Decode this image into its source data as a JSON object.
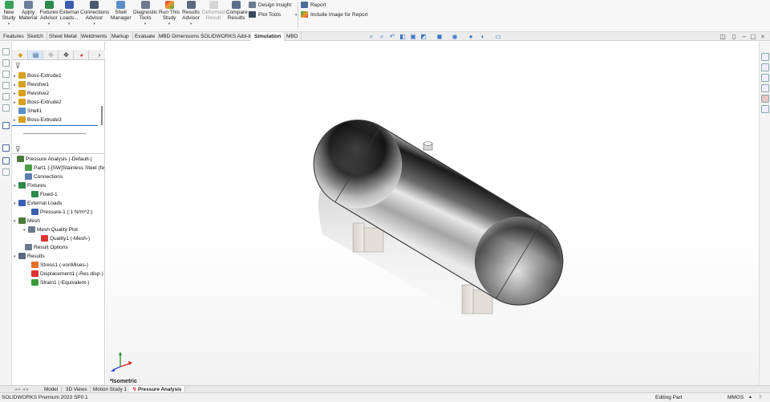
{
  "ribbon": {
    "buttons": [
      {
        "line1": "New",
        "line2": "Study",
        "icon": "new-study-icon"
      },
      {
        "line1": "Apply",
        "line2": "Material",
        "icon": "apply-material-icon"
      },
      {
        "line1": "Fixtures",
        "line2": "Advisor",
        "icon": "fixtures-icon"
      },
      {
        "line1": "External",
        "line2": "Loads...",
        "icon": "external-loads-icon"
      },
      {
        "line1": "Connections",
        "line2": "Advisor",
        "icon": "connections-icon"
      },
      {
        "line1": "Shell",
        "line2": "Manager",
        "icon": "shell-manager-icon"
      },
      {
        "line1": "Diagnostic",
        "line2": "Tools",
        "icon": "diagnostic-tools-icon"
      },
      {
        "line1": "Run This",
        "line2": "Study",
        "icon": "run-study-icon"
      },
      {
        "line1": "Results",
        "line2": "Advisor",
        "icon": "results-advisor-icon"
      },
      {
        "line1": "Deformed",
        "line2": "Result",
        "icon": "deformed-result-icon"
      },
      {
        "line1": "Compare",
        "line2": "Results",
        "icon": "compare-results-icon"
      }
    ],
    "design_insight": "Design Insight",
    "plot_tools": "Plot Tools",
    "report": "Report",
    "include_image": "Include Image for Report"
  },
  "command_tabs": [
    "Features",
    "Sketch",
    "Sheet Metal",
    "Weldments",
    "Markup",
    "Evaluate",
    "MBD Dimensions",
    "SOLIDWORKS Add-Ins",
    "Simulation",
    "MBD"
  ],
  "feature_tree": [
    {
      "label": "Boss-Extrude1",
      "expandable": true
    },
    {
      "label": "Revolve1",
      "expandable": true
    },
    {
      "label": "Revolve2",
      "expandable": true
    },
    {
      "label": "Boss-Extrude2",
      "expandable": true
    },
    {
      "label": "Shell1",
      "expandable": false
    },
    {
      "label": "Boss-Extrude3",
      "expandable": true
    }
  ],
  "study_tree": {
    "root": "Pressure Analysis (-Default-)",
    "part": "Part1 (-[SW]Stainless Steel (fe",
    "connections": "Connections",
    "fixtures": "Fixtures",
    "fixed": "Fixed-1",
    "external_loads": "External Loads",
    "pressure": "Pressure-1 (:1 N/m^2:)",
    "mesh": "Mesh",
    "mesh_quality_plot": "Mesh Quality Plot",
    "quality1": "Quality1 (-Mesh-)",
    "result_options": "Result Options",
    "results": "Results",
    "stress": "Stress1 (-vonMises-)",
    "displacement": "Displacement1 (-Res disp-)",
    "strain": "Strain1 (-Equivalent-)"
  },
  "viewport": {
    "view_label": "*Isometric"
  },
  "bottom_tabs": [
    "Model",
    "3D Views",
    "Motion Study 1",
    "Pressure Analysis"
  ],
  "status": {
    "product": "SOLIDWORKS Premium 2023 SP0.1",
    "mode": "Editing Part",
    "units": "MMGS"
  },
  "colors": {
    "accent": "#2f6fc4",
    "active_tab": "#ffffff",
    "ribbon_bg": "#f7f7f7"
  }
}
